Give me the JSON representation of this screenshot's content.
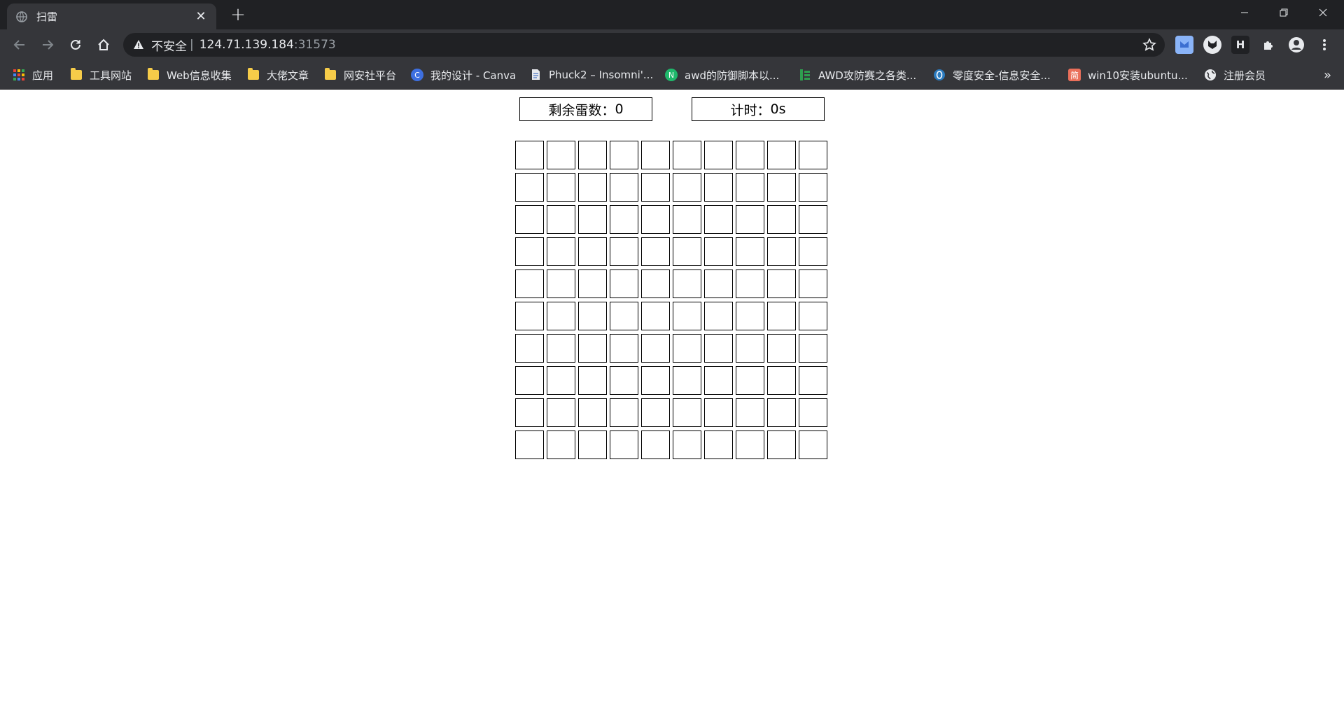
{
  "browser": {
    "tab": {
      "title": "扫雷"
    },
    "address": {
      "security_label": "不安全",
      "separator": "|",
      "host": "124.71.139.184",
      "port": ":31573"
    },
    "bookmarks": [
      {
        "label": "应用",
        "icon": "apps-grid-icon"
      },
      {
        "label": "工具网站",
        "icon": "folder-icon"
      },
      {
        "label": "Web信息收集",
        "icon": "folder-icon"
      },
      {
        "label": "大佬文章",
        "icon": "folder-icon"
      },
      {
        "label": "网安社平台",
        "icon": "folder-icon"
      },
      {
        "label": "我的设计 - Canva",
        "icon": "canva-icon"
      },
      {
        "label": "Phuck2 – Insomni'...",
        "icon": "page-icon"
      },
      {
        "label": "awd的防御脚本以...",
        "icon": "n-logo-icon"
      },
      {
        "label": "AWD攻防赛之各类...",
        "icon": "green-bars-icon"
      },
      {
        "label": "零度安全-信息安全...",
        "icon": "zero-logo-icon"
      },
      {
        "label": "win10安装ubuntu...",
        "icon": "jianshu-icon"
      },
      {
        "label": "注册会员",
        "icon": "globe-icon"
      }
    ],
    "bookmarks_overflow": "»"
  },
  "game": {
    "mines_label": "剩余雷数：",
    "mines_value": "0",
    "timer_label": "计时：",
    "timer_value": "0s",
    "rows": 10,
    "cols": 10
  },
  "colors": {
    "chrome_dark": "#202124",
    "chrome_toolbar": "#35363a",
    "chrome_text": "#e8eaed",
    "folder": "#f6cc49",
    "cell_border": "#000000"
  }
}
